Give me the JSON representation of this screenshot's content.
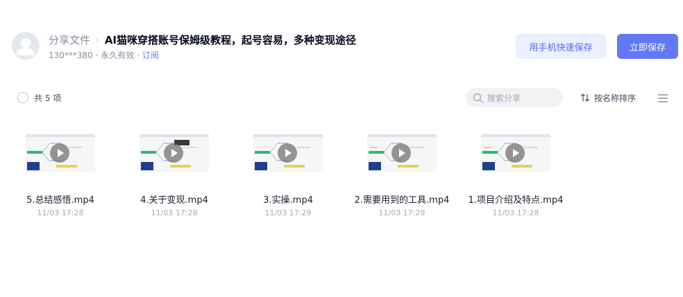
{
  "header": {
    "breadcrumb_root": "分享文件",
    "breadcrumb_separator": "›",
    "title": "AI猫咪穿搭账号保姆级教程，起号容易，多种变现途径",
    "sharer": "130***380",
    "separator": " · ",
    "validity": "永久有效",
    "subscribe_label": "订阅"
  },
  "actions": {
    "phone_save_label": "用手机快速保存",
    "save_now_label": "立即保存"
  },
  "toolbar": {
    "count_label": "共 5 项",
    "search_placeholder": "搜索分享",
    "sort_label": "按名称排序"
  },
  "files": [
    {
      "name": "5.总结感悟.mp4",
      "date": "11/03 17:28"
    },
    {
      "name": "4.关于变现.mp4",
      "date": "11/03 17:28"
    },
    {
      "name": "3.实操.mp4",
      "date": "11/03 17:29"
    },
    {
      "name": "2.需要用到的工具.mp4",
      "date": "11/03 17:28"
    },
    {
      "name": "1.项目介绍及特点.mp4",
      "date": "11/03 17:28"
    }
  ],
  "colors": {
    "primary": "#6378f7",
    "secondary_bg": "#eaf0ff",
    "link": "#5c7cf5",
    "muted_text": "#878c9c"
  },
  "icons": {
    "avatar": "default-user-avatar",
    "search": "search-icon",
    "sort": "sort-icon",
    "menu": "menu-icon",
    "play": "play-icon"
  }
}
